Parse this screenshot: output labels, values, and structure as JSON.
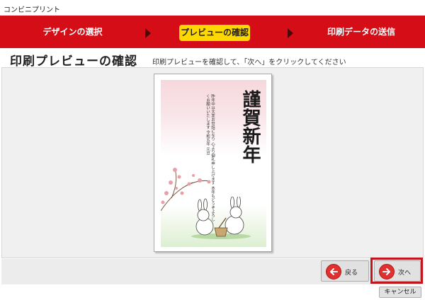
{
  "window": {
    "title": "コンビニプリント"
  },
  "steps": [
    {
      "label": "デザインの選択",
      "active": false
    },
    {
      "label": "プレビューの確認",
      "active": true
    },
    {
      "label": "印刷データの送信",
      "active": false
    }
  ],
  "page": {
    "title": "印刷プレビューの確認",
    "instruction": "印刷プレビューを確認して、「次へ」をクリックしてください"
  },
  "card": {
    "greeting": "謹賀新年",
    "message": "昨年中は大変お世話になり 心より御礼申し上げます 本年もどうぞよろしくお願いいたします 令和五年 元旦"
  },
  "buttons": {
    "back_label": "戻る",
    "next_label": "次へ",
    "cancel_label": "キャンセル"
  },
  "colors": {
    "step_bar": "#d40d17",
    "active_step": "#ffd800",
    "highlight_frame": "#c4141c",
    "arrow_circle": "#e03030"
  },
  "icons": {
    "back": "arrow-left-icon",
    "next": "arrow-right-icon",
    "step_separator": "triangle-right-icon"
  }
}
